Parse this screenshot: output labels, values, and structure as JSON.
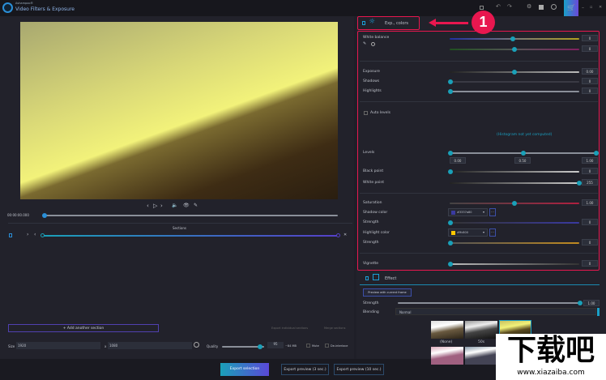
{
  "app": {
    "brand": "Ashampoo®",
    "title": "Video Filters & Exposure"
  },
  "window_icons": [
    "save-icon",
    "undo-icon",
    "redo-icon",
    "gear-icon",
    "image-icon",
    "info-icon",
    "cart-icon",
    "minimize-icon",
    "maximize-icon",
    "close-icon"
  ],
  "player": {
    "timecode": "00:00:00.000",
    "progress": 0.0
  },
  "sections": {
    "title": "Sections",
    "add_label": "+ Add another section",
    "export_individual": "Export individual sections",
    "merge": "Merge sections"
  },
  "output": {
    "size_label": "Size",
    "width": "1920",
    "x": "x",
    "height": "1080",
    "quality_label": "Quality",
    "quality": "95",
    "quality_fraction": 0.9,
    "size_estimate": "~84 MB",
    "mute": "Mute",
    "deinterlace": "De-interlace"
  },
  "footer": {
    "export_selection": "Export selection",
    "export_preview_3": "Export preview (3 sec.)",
    "export_preview_10": "Export preview (10 sec.)"
  },
  "tab": {
    "label": "Exp., colors"
  },
  "annotation": {
    "number": "1",
    "color": "#e8174f"
  },
  "exposure": {
    "white_balance": {
      "label": "White balance",
      "value1": "0",
      "value2": "0"
    },
    "exposure": {
      "label": "Exposure",
      "value": "0.00"
    },
    "shadows": {
      "label": "Shadows",
      "value": "0"
    },
    "highlights": {
      "label": "Highlights",
      "value": "0"
    },
    "auto_levels": {
      "label": "Auto levels"
    },
    "histogram_note": "(Histogram not yet computed)",
    "levels": {
      "label": "Levels",
      "low": "0.00",
      "mid": "0.50",
      "high": "1.00"
    },
    "black_point": {
      "label": "Black point",
      "value": "0"
    },
    "white_point": {
      "label": "White point",
      "value": "255"
    },
    "saturation": {
      "label": "Saturation",
      "value": "1.00"
    },
    "shadow_color": {
      "label": "Shadow color",
      "value": "#3337a80",
      "swatch": "#3a3aa0"
    },
    "shadow_strength": {
      "label": "Strength",
      "value": "0"
    },
    "highlight_color": {
      "label": "Highlight color",
      "value": "#ffc800",
      "swatch": "#ffc800"
    },
    "highlight_strength": {
      "label": "Strength",
      "value": "0"
    },
    "vignette": {
      "label": "Vignette",
      "value": "0"
    }
  },
  "effect": {
    "title": "Effect",
    "preview_btn": "Preview with current frame",
    "strength_label": "Strength",
    "strength": "1.00",
    "blending_label": "Blending",
    "blending": "Normal",
    "presets": [
      "(None)",
      "50s",
      ""
    ]
  },
  "watermark": {
    "text": "下载吧",
    "url": "www.xiazaiba.com"
  }
}
